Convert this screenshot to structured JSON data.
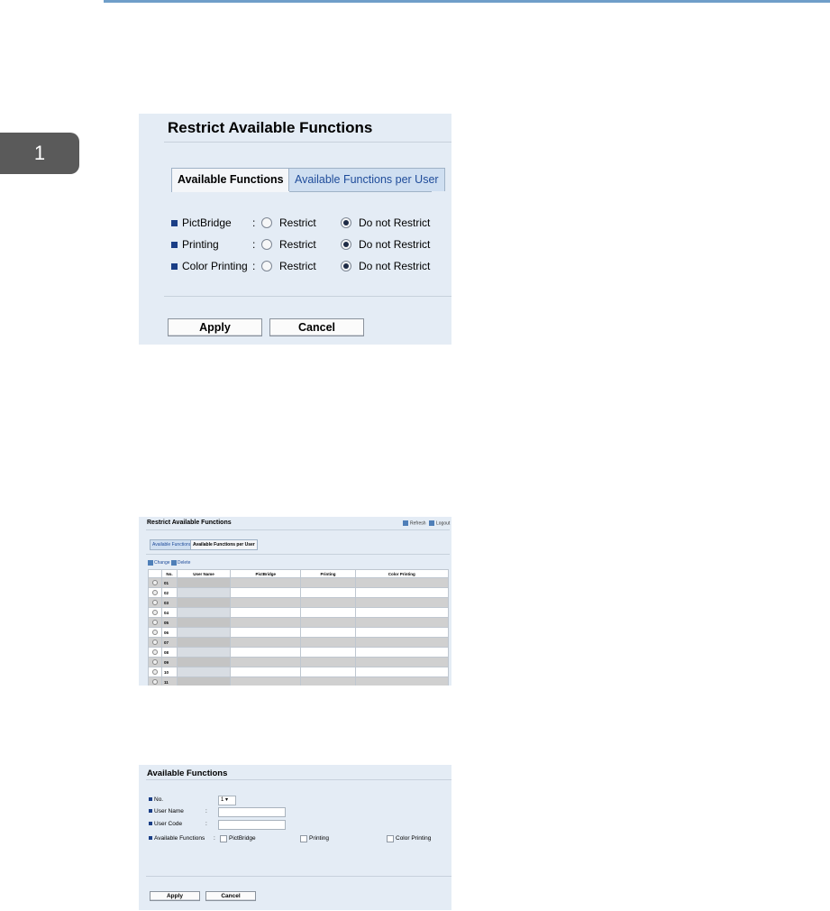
{
  "chapter_number": "1",
  "panel1": {
    "title": "Restrict Available Functions",
    "tabs": [
      "Available Functions",
      "Available Functions per User"
    ],
    "rows": [
      {
        "label": "PictBridge",
        "option1": "Restrict",
        "option2": "Do not Restrict",
        "selected": "Do not Restrict"
      },
      {
        "label": "Printing",
        "option1": "Restrict",
        "option2": "Do not Restrict",
        "selected": "Do not Restrict"
      },
      {
        "label": "Color Printing",
        "option1": "Restrict",
        "option2": "Do not Restrict",
        "selected": "Do not Restrict"
      }
    ],
    "colon": ":",
    "apply": "Apply",
    "cancel": "Cancel"
  },
  "panel2": {
    "title": "Restrict Available Functions",
    "refresh": "Refresh",
    "logout": "Logout",
    "tabs": [
      "Available Functions",
      "Available Functions per User"
    ],
    "change": "Change",
    "delete": "Delete",
    "columns": [
      "No.",
      "User Name",
      "PictBridge",
      "Printing",
      "Color Printing"
    ],
    "rows": [
      "01",
      "02",
      "03",
      "04",
      "05",
      "06",
      "07",
      "08",
      "09",
      "10",
      "11"
    ]
  },
  "panel3": {
    "title": "Available Functions",
    "no_label": "No.",
    "no_value": "1",
    "user_name_label": "User Name",
    "user_name_value": "",
    "user_code_label": "User Code",
    "user_code_value": "",
    "available_functions_label": "Available Functions",
    "functions": [
      "PictBridge",
      "Printing",
      "Color Printing"
    ],
    "colon": ":",
    "apply": "Apply",
    "cancel": "Cancel"
  }
}
